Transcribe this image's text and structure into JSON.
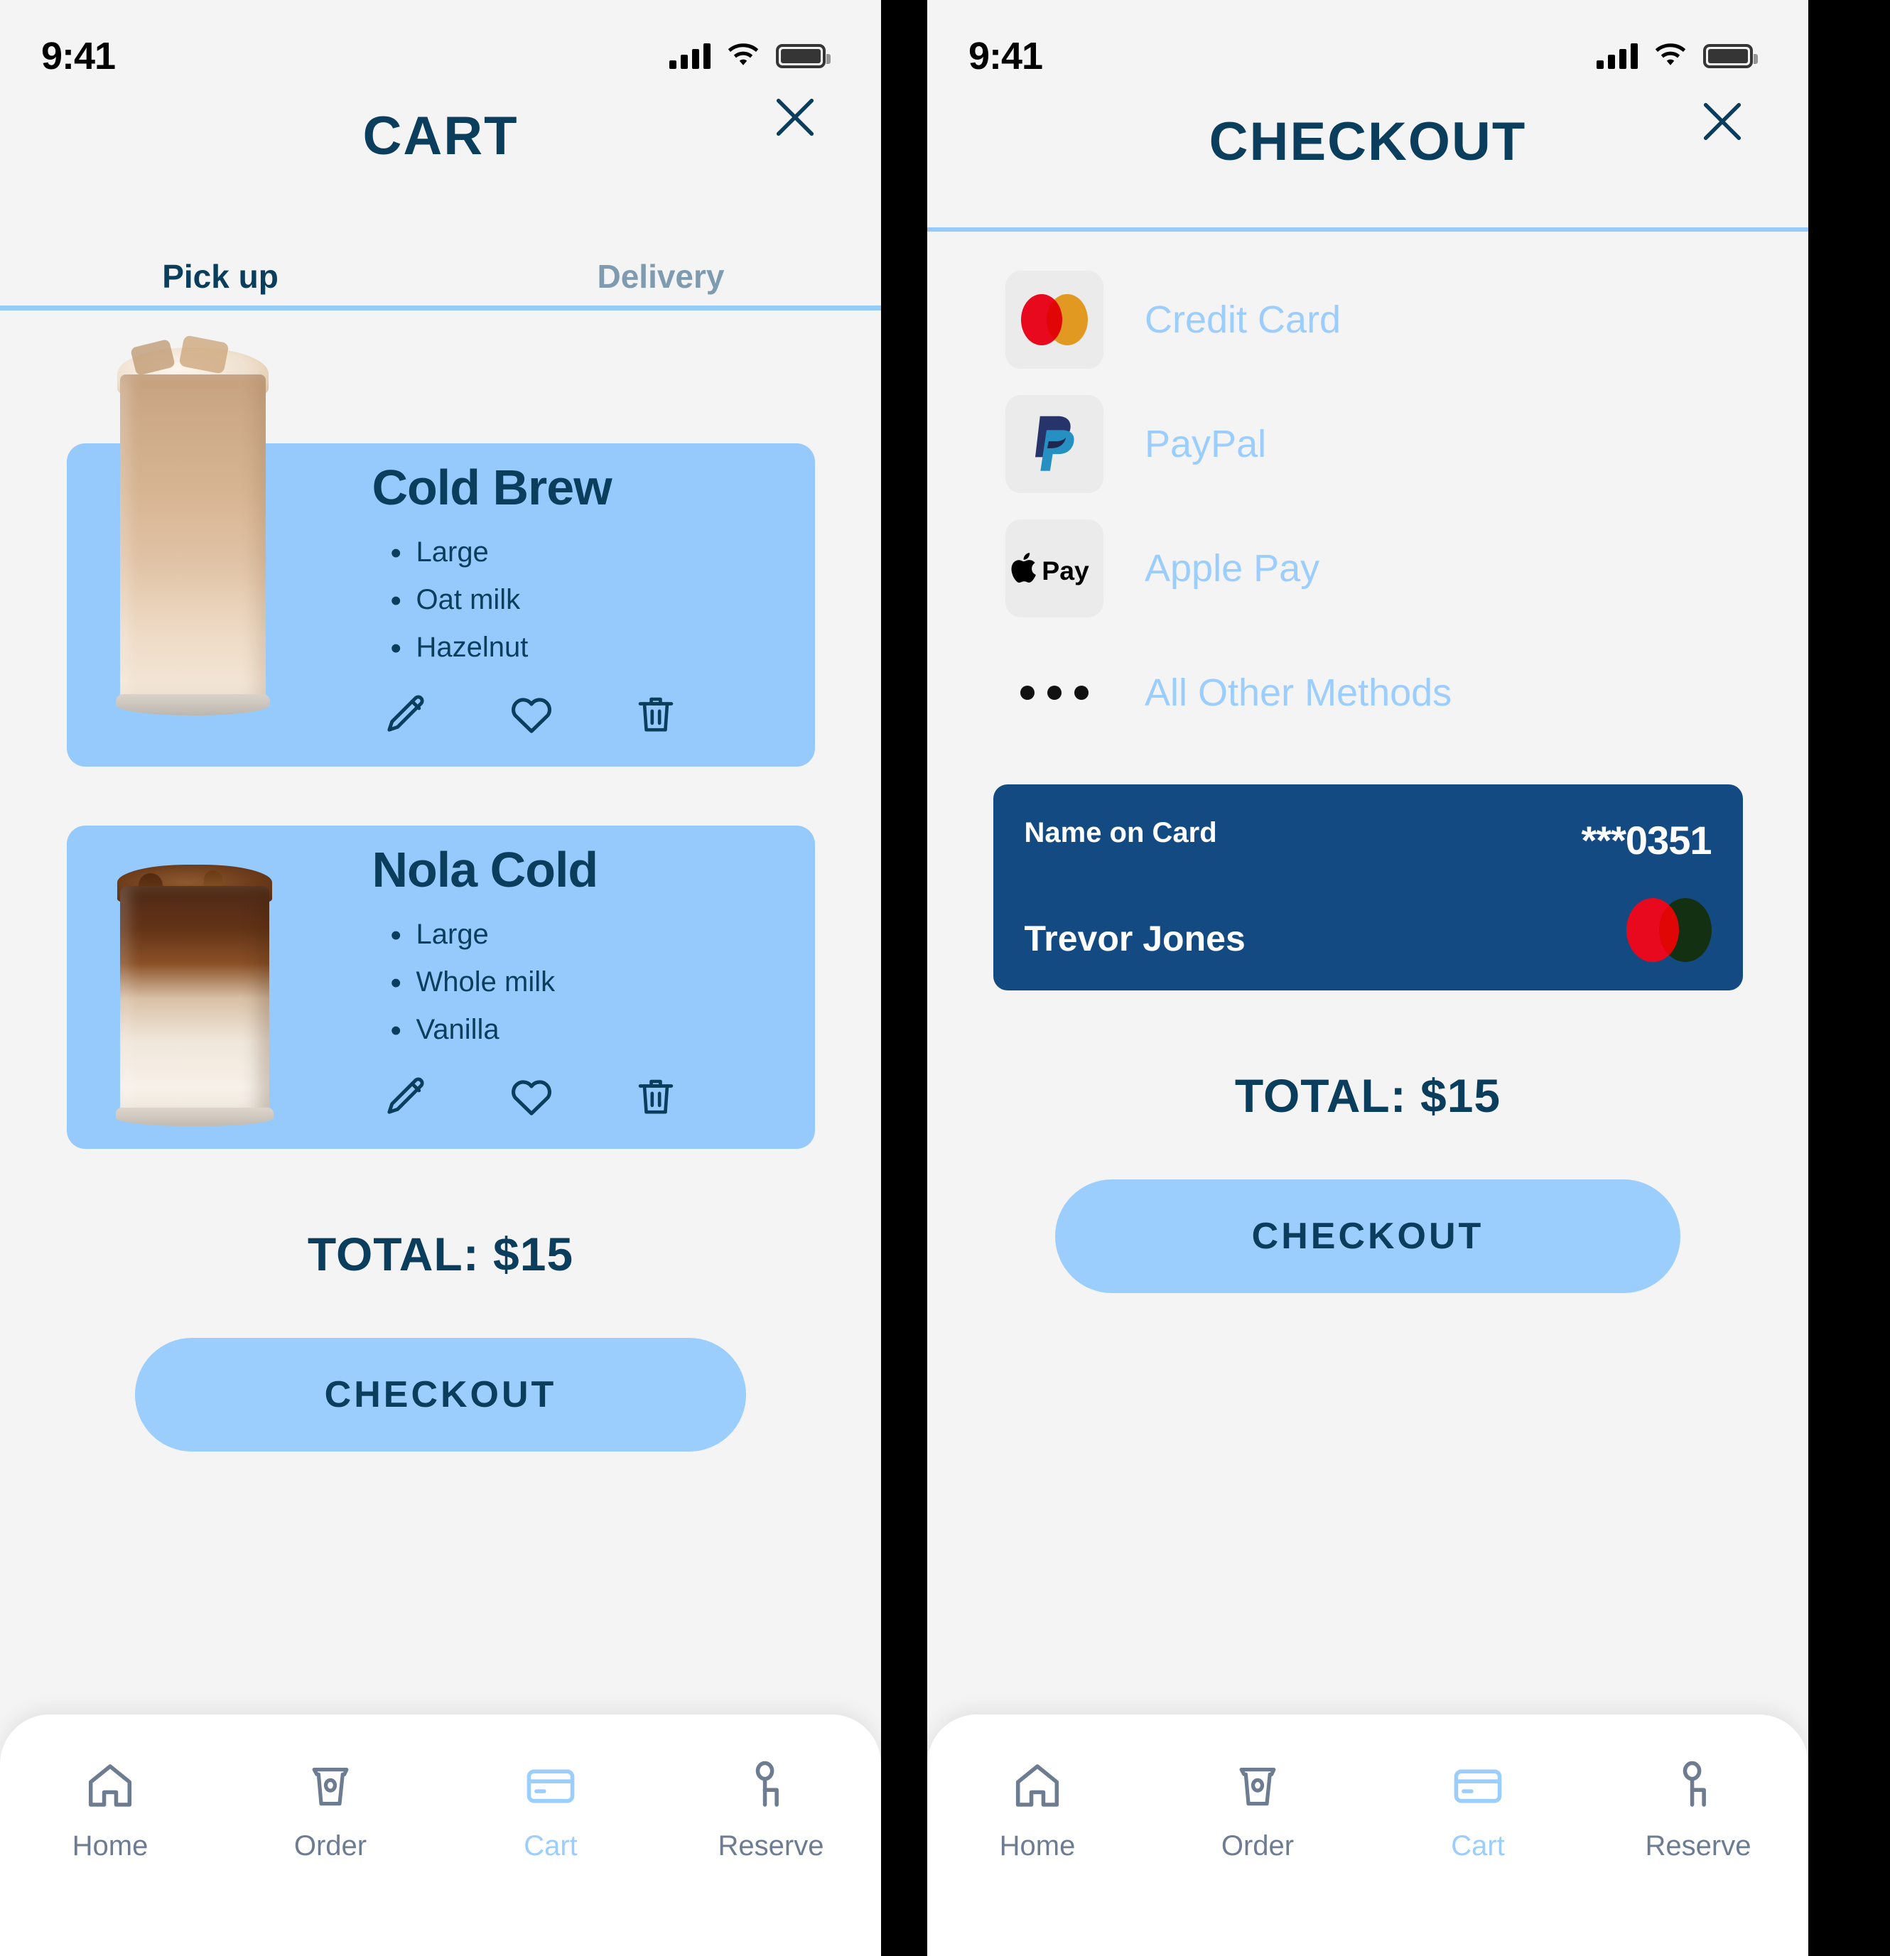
{
  "colors": {
    "accent_light_blue": "#9bcdfd",
    "card_blue": "#96cafd",
    "navy": "#0b3e5c",
    "card_tile_navy": "#144a82",
    "muted": "#6d7c91",
    "screen_bg": "#f4f4f4",
    "mastercard_red": "#e9091e",
    "mastercard_yellow": "#f5a623"
  },
  "status_bar": {
    "time": "9:41",
    "signal_icon": "cellular-signal-icon",
    "wifi_icon": "wifi-icon",
    "battery_icon": "battery-full-icon"
  },
  "cart_screen": {
    "title": "CART",
    "close_icon": "close-icon",
    "tabs": [
      {
        "label": "Pick up",
        "active": true
      },
      {
        "label": "Delivery",
        "active": false
      }
    ],
    "items": [
      {
        "name": "Cold Brew",
        "image_alt": "iced-coffee-tall-glass",
        "options": [
          "Large",
          "Oat milk",
          "Hazelnut"
        ],
        "actions": [
          "edit-pencil-icon",
          "heart-icon",
          "trash-icon"
        ]
      },
      {
        "name": "Nola Cold",
        "image_alt": "iced-coffee-can-glass",
        "options": [
          "Large",
          "Whole milk",
          "Vanilla"
        ],
        "actions": [
          "edit-pencil-icon",
          "heart-icon",
          "trash-icon"
        ]
      }
    ],
    "total": "TOTAL: $15",
    "checkout_label": "CHECKOUT"
  },
  "checkout_screen": {
    "title": "CHECKOUT",
    "close_icon": "close-icon",
    "payment_methods": [
      {
        "label": "Credit Card",
        "logo": "mastercard-logo"
      },
      {
        "label": "PayPal",
        "logo": "paypal-logo"
      },
      {
        "label": "Apple Pay",
        "logo": "apple-pay-logo"
      },
      {
        "label": "All Other Methods",
        "logo": "ellipsis-icon"
      }
    ],
    "saved_card": {
      "label": "Name on Card",
      "masked_number": "***0351",
      "holder": "Trevor Jones",
      "brand_logo": "mastercard-logo"
    },
    "total": "TOTAL: $15",
    "checkout_label": "CHECKOUT"
  },
  "bottom_nav": {
    "items": [
      {
        "label": "Home",
        "icon": "home-icon",
        "active": false
      },
      {
        "label": "Order",
        "icon": "coffee-cup-icon",
        "active": false
      },
      {
        "label": "Cart",
        "icon": "credit-card-icon",
        "active": true
      },
      {
        "label": "Reserve",
        "icon": "person-seat-icon",
        "active": false
      }
    ]
  }
}
